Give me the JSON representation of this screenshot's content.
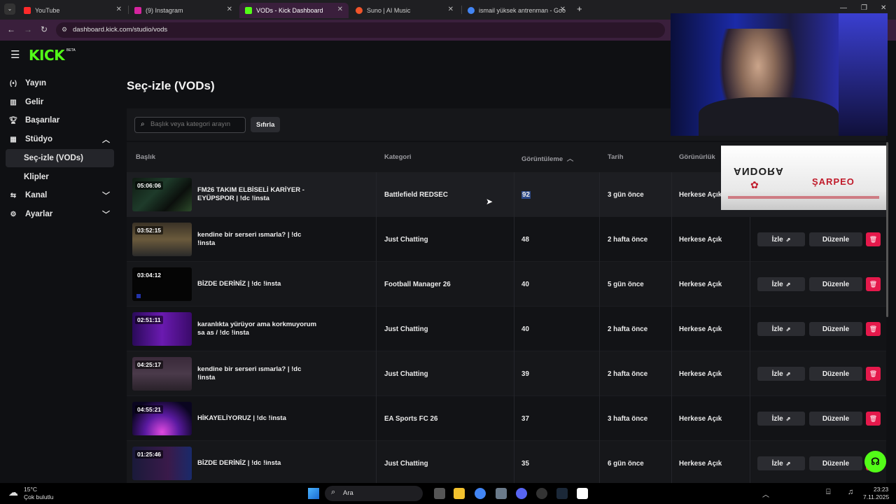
{
  "browser": {
    "tabs": [
      {
        "label": "YouTube",
        "favicon_color": "#ff2a2a"
      },
      {
        "label": "(9) Instagram",
        "favicon_color": "#d6249f"
      },
      {
        "label": "VODs - Kick Dashboard",
        "favicon_color": "#53fc18",
        "active": true
      },
      {
        "label": "Suno | AI Music",
        "favicon_color": "#f0542a"
      },
      {
        "label": "ismail yüksek antrenman - Goo",
        "favicon_color": "#4285f4"
      }
    ],
    "new_tab_label": "+",
    "url": "dashboard.kick.com/studio/vods"
  },
  "brand": {
    "logo_text": "KICK",
    "logo_sup": "BETA",
    "accent": "#53fc18"
  },
  "sidebar": {
    "items": [
      {
        "label": "Yayın",
        "icon": "broadcast-icon"
      },
      {
        "label": "Gelir",
        "icon": "revenue-icon"
      },
      {
        "label": "Başarılar",
        "icon": "trophy-icon"
      },
      {
        "label": "Stüdyo",
        "icon": "studio-icon",
        "expanded": true
      },
      {
        "label": "Seç-izle (VODs)",
        "active": true
      },
      {
        "label": "Klipler"
      },
      {
        "label": "Kanal",
        "icon": "channel-icon"
      },
      {
        "label": "Ayarlar",
        "icon": "settings-icon"
      }
    ]
  },
  "page": {
    "title": "Seç-izle (VODs)"
  },
  "filters": {
    "search_placeholder": "Başlık veya kategori arayın",
    "reset_label": "Sıfırla"
  },
  "table": {
    "headers": {
      "title": "Başlık",
      "category": "Kategori",
      "views": "Görüntüleme",
      "date": "Tarih",
      "visibility": "Görünürlük"
    },
    "watch_label": "İzle",
    "edit_label": "Düzenle",
    "rows": [
      {
        "duration": "05:06:06",
        "title": "FM26 TAKIM ELBİSELİ KARİYER - EYÜPSPOR | !dc !insta",
        "category": "Battlefield REDSEC",
        "views": "92",
        "date": "3 gün önce",
        "visibility": "Herkese Açık"
      },
      {
        "duration": "03:52:15",
        "title": "kendine bir serseri ısmarla? | !dc !insta",
        "category": "Just Chatting",
        "views": "48",
        "date": "2 hafta önce",
        "visibility": "Herkese Açık"
      },
      {
        "duration": "03:04:12",
        "title": "BİZDE DERİNİZ | !dc !insta",
        "category": "Football Manager 26",
        "views": "40",
        "date": "5 gün önce",
        "visibility": "Herkese Açık"
      },
      {
        "duration": "02:51:11",
        "title": "karanlıkta yürüyor ama korkmuyorum sa as / !dc !insta",
        "category": "Just Chatting",
        "views": "40",
        "date": "2 hafta önce",
        "visibility": "Herkese Açık"
      },
      {
        "duration": "04:25:17",
        "title": "kendine bir serseri ısmarla? | !dc !insta",
        "category": "Just Chatting",
        "views": "39",
        "date": "2 hafta önce",
        "visibility": "Herkese Açık"
      },
      {
        "duration": "04:55:21",
        "title": "HİKAYELİYORUZ | !dc !insta",
        "category": "EA Sports FC 26",
        "views": "37",
        "date": "3 hafta önce",
        "visibility": "Herkese Açık"
      },
      {
        "duration": "01:25:46",
        "title": "BİZDE DERİNİZ | !dc !insta",
        "category": "Just Chatting",
        "views": "35",
        "date": "6 gün önce",
        "visibility": "Herkese Açık"
      }
    ]
  },
  "overlay_banner": {
    "left_text": "ANDORA",
    "right_text": "ŞARPEO"
  },
  "taskbar": {
    "weather_temp": "15°C",
    "weather_desc": "Çok bulutlu",
    "search_label": "Ara",
    "time": "23:23",
    "date": "7.11.2025"
  }
}
